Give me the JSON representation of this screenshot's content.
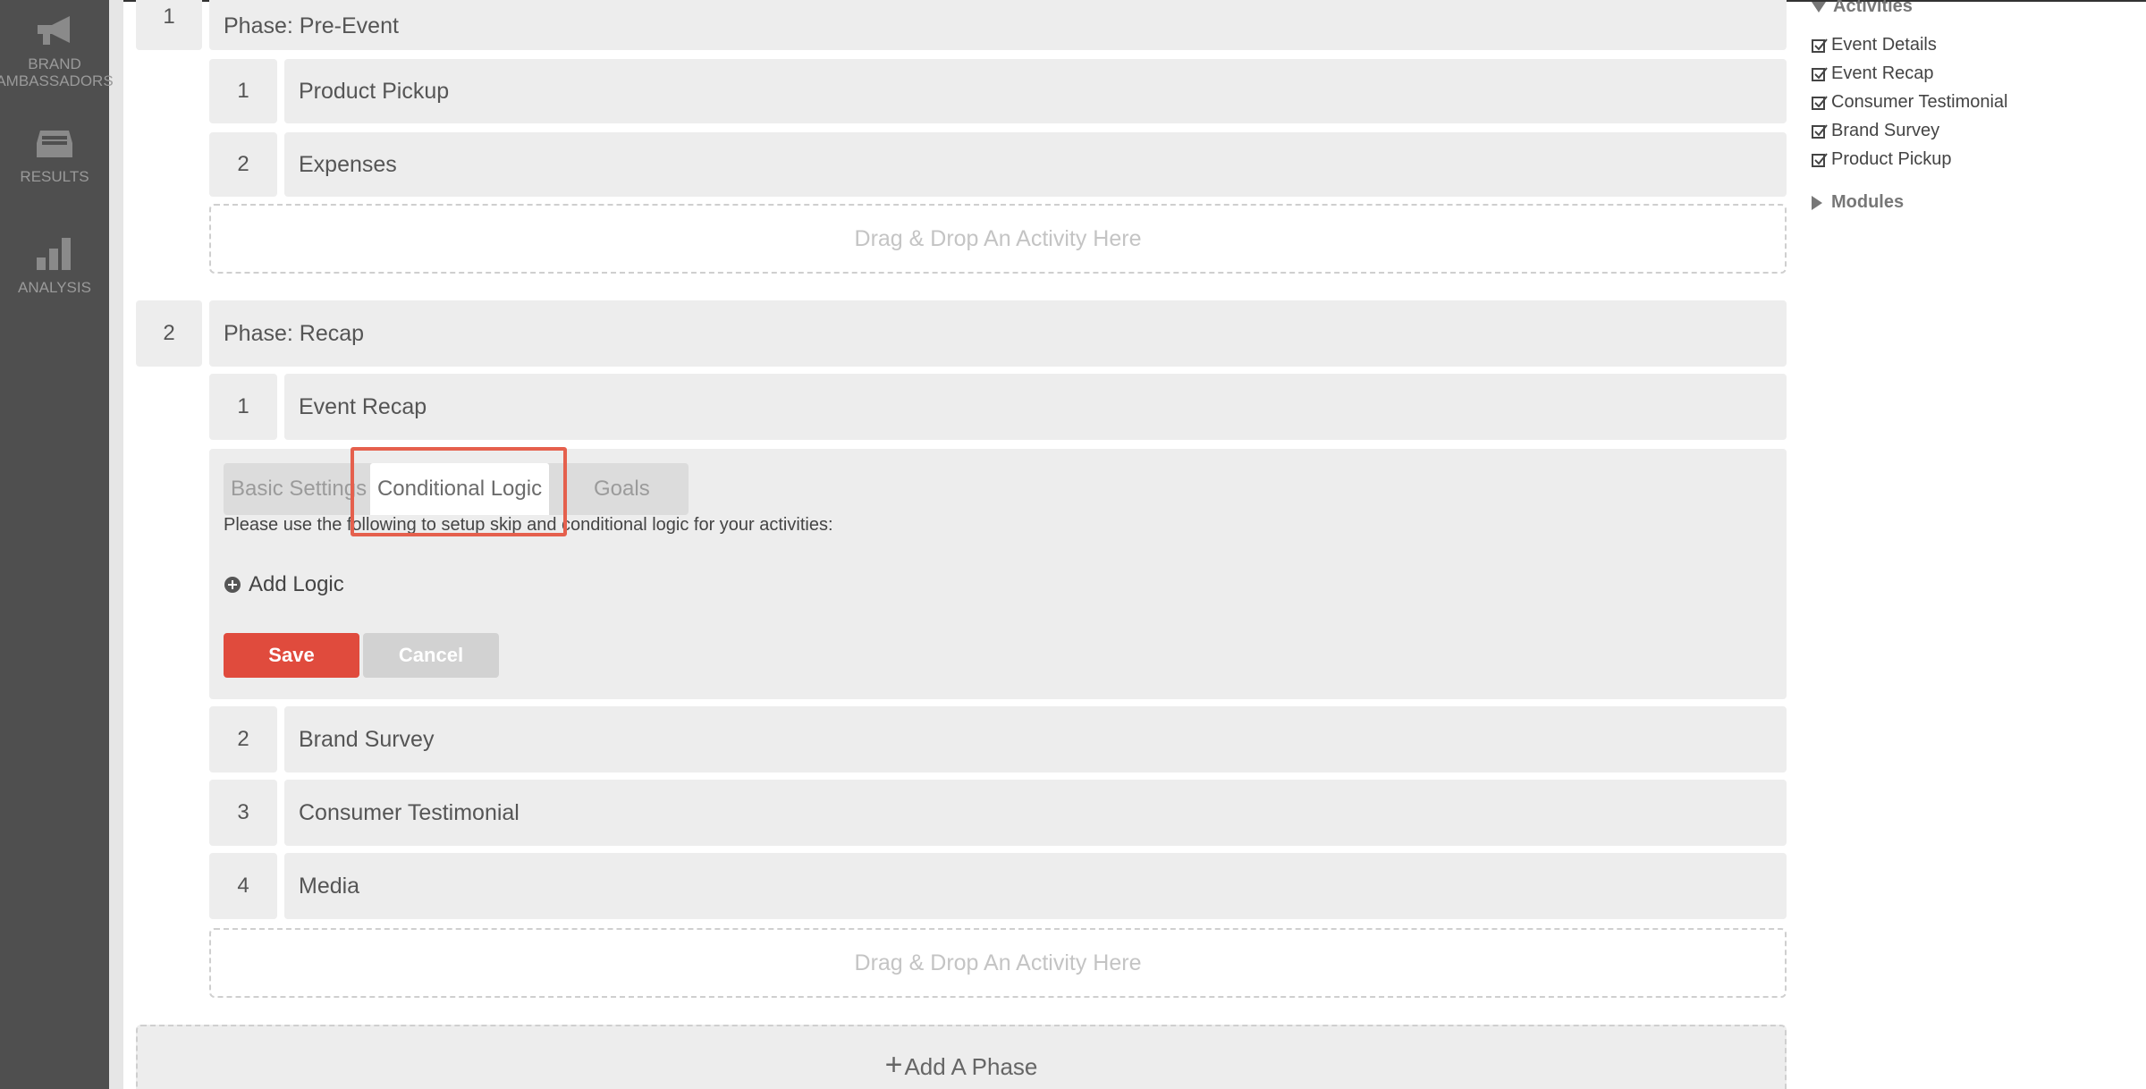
{
  "sidebar": {
    "items": [
      {
        "label": "BRAND AMBASSADORS",
        "icon": "megaphone-icon"
      },
      {
        "label": "RESULTS",
        "icon": "inbox-icon"
      },
      {
        "label": "ANALYSIS",
        "icon": "bar-chart-icon"
      }
    ]
  },
  "phases": [
    {
      "number": "1",
      "title": "Phase: Pre-Event",
      "activities": [
        {
          "number": "1",
          "name": "Product Pickup"
        },
        {
          "number": "2",
          "name": "Expenses"
        }
      ],
      "drop_label": "Drag & Drop An Activity Here"
    },
    {
      "number": "2",
      "title": "Phase: Recap",
      "activities": [
        {
          "number": "1",
          "name": "Event Recap"
        },
        {
          "number": "2",
          "name": "Brand Survey"
        },
        {
          "number": "3",
          "name": "Consumer Testimonial"
        },
        {
          "number": "4",
          "name": "Media"
        }
      ],
      "drop_label": "Drag & Drop An Activity Here"
    }
  ],
  "editor": {
    "tabs": [
      "Basic Settings",
      "Conditional Logic",
      "Goals"
    ],
    "active_tab": "Conditional Logic",
    "hint": "Please use the following to setup skip and conditional logic for your activities:",
    "add_logic": "Add Logic",
    "save": "Save",
    "cancel": "Cancel"
  },
  "add_phase": "Add A Phase",
  "right_panel": {
    "activities_heading": "Activities",
    "activities": [
      "Event Details",
      "Event Recap",
      "Consumer Testimonial",
      "Brand Survey",
      "Product Pickup"
    ],
    "modules_heading": "Modules"
  },
  "colors": {
    "sidebar": "#4f4f4f",
    "save": "#e04b3d",
    "highlight": "#e5604d"
  }
}
